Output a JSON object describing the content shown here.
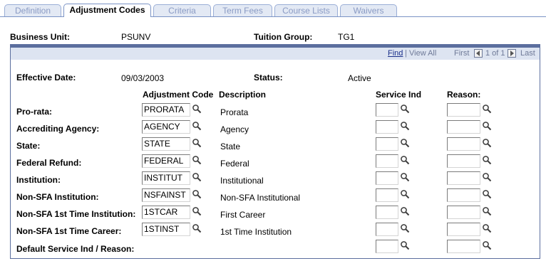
{
  "tabs": [
    {
      "label": "Definition",
      "active": false
    },
    {
      "label": "Adjustment Codes",
      "active": true
    },
    {
      "label": "Criteria",
      "active": false
    },
    {
      "label": "Term Fees",
      "active": false
    },
    {
      "label": "Course Lists",
      "active": false
    },
    {
      "label": "Waivers",
      "active": false
    }
  ],
  "header": {
    "business_unit_label": "Business Unit:",
    "business_unit_value": "PSUNV",
    "tuition_group_label": "Tuition Group:",
    "tuition_group_value": "TG1"
  },
  "nav": {
    "find": "Find",
    "separator": "|",
    "view_all": "View All",
    "first": "First",
    "page_info": "1 of 1",
    "last": "Last"
  },
  "effective": {
    "effective_date_label": "Effective Date:",
    "effective_date_value": "09/03/2003",
    "status_label": "Status:",
    "status_value": "Active"
  },
  "columns": {
    "adjustment_code": "Adjustment Code",
    "description": "Description",
    "service_ind": "Service Ind",
    "reason": "Reason:"
  },
  "rows": [
    {
      "label": "Pro-rata:",
      "code": "PRORATA",
      "description": "Prorata",
      "service_ind": "",
      "reason": ""
    },
    {
      "label": "Accrediting Agency:",
      "code": "AGENCY",
      "description": "Agency",
      "service_ind": "",
      "reason": ""
    },
    {
      "label": "State:",
      "code": "STATE",
      "description": "State",
      "service_ind": "",
      "reason": ""
    },
    {
      "label": "Federal Refund:",
      "code": "FEDERAL",
      "description": "Federal",
      "service_ind": "",
      "reason": ""
    },
    {
      "label": "Institution:",
      "code": "INSTITUT",
      "description": "Institutional",
      "service_ind": "",
      "reason": ""
    },
    {
      "label": "Non-SFA Institution:",
      "code": "NSFAINST",
      "description": "Non-SFA Institutional",
      "service_ind": "",
      "reason": ""
    },
    {
      "label": "Non-SFA 1st Time Institution:",
      "code": "1STCAR",
      "description": "First Career",
      "service_ind": "",
      "reason": ""
    },
    {
      "label": "Non-SFA 1st Time Career:",
      "code": "1STINST",
      "description": "1st Time Institution",
      "service_ind": "",
      "reason": ""
    }
  ],
  "default_row": {
    "label": "Default Service Ind / Reason:",
    "service_ind": "",
    "reason": ""
  },
  "icons": {
    "lookup": "magnifier-lookup-icon",
    "first": "left-arrow-icon",
    "last": "right-arrow-icon"
  },
  "colors": {
    "tab_active_border": "#7b93c5",
    "area_header": "#5b6e9e",
    "nav_bg": "#dde4f1",
    "link": "#1a2f8a"
  }
}
